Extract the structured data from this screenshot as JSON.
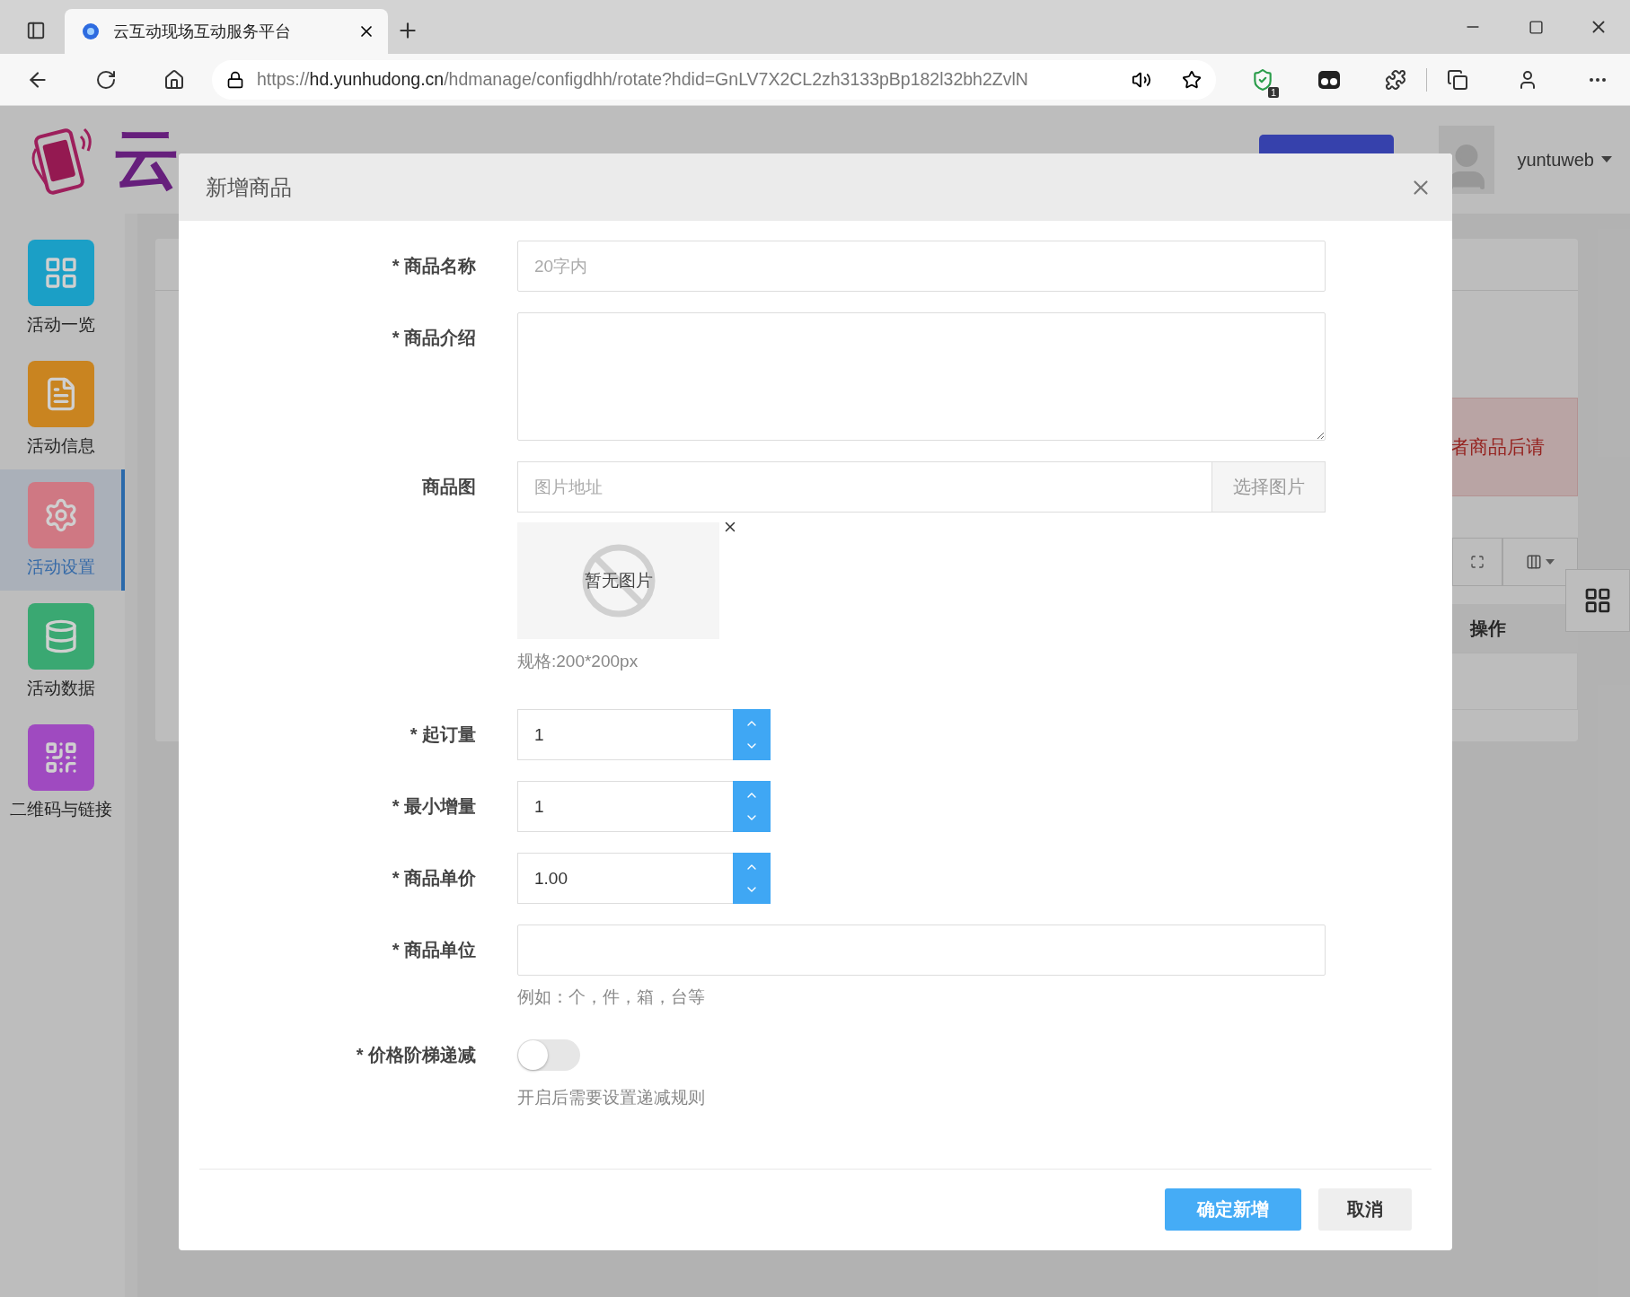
{
  "browser": {
    "tab_title": "云互动现场互动服务平台",
    "url": "https://**hd.yunhudong.cn**/hdmanage/configdhh/rotate?hdid=GnLV7X2CL2zh3133pBp182l32bh2ZvlN",
    "extension_badge": "1"
  },
  "header": {
    "logo_text": "云",
    "user": "yuntuweb"
  },
  "sidebar": {
    "items": [
      {
        "label": "活动一览",
        "kind": "grid",
        "color": "#1b9fc6",
        "selected": false
      },
      {
        "label": "活动信息",
        "kind": "document",
        "color": "#c98420",
        "selected": false
      },
      {
        "label": "活动设置",
        "kind": "gear",
        "color": "#cf7883",
        "selected": true
      },
      {
        "label": "活动数据",
        "kind": "database",
        "color": "#3aa872",
        "selected": false
      },
      {
        "label": "二维码与链接",
        "kind": "qrcode",
        "color": "#9f4ac0",
        "selected": false
      }
    ]
  },
  "content": {
    "alert_text": "者商品后请",
    "table_header": "操作"
  },
  "modal": {
    "title": "新增商品",
    "fields": [
      {
        "kind": "text",
        "label": "* 商品名称",
        "placeholder": "20字内"
      },
      {
        "kind": "textarea",
        "label": "* 商品介绍"
      },
      {
        "kind": "image",
        "label": "商品图",
        "placeholder": "图片地址",
        "button": "选择图片",
        "preview_text": "暂无图片",
        "hint": "规格:200*200px"
      },
      {
        "kind": "number",
        "label": "* 起订量",
        "value": "1"
      },
      {
        "kind": "number",
        "label": "* 最小增量",
        "value": "1"
      },
      {
        "kind": "number",
        "label": "* 商品单价",
        "value": "1.00"
      },
      {
        "kind": "text",
        "label": "* 商品单位",
        "hint": "例如：个，件，箱，台等"
      },
      {
        "kind": "switch",
        "label": "* 价格阶梯递减",
        "on": false,
        "hint": "开启后需要设置递减规则"
      }
    ],
    "buttons": [
      {
        "label": "确定新增",
        "kind": "primary"
      },
      {
        "label": "取消",
        "kind": "default"
      }
    ]
  }
}
